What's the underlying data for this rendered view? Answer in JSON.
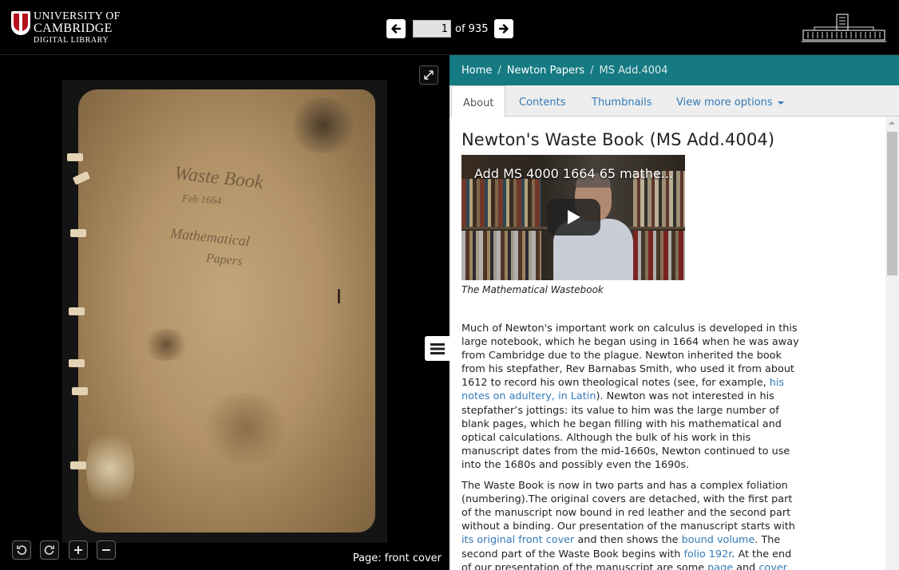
{
  "header": {
    "logo": {
      "line1": "UNIVERSITY OF",
      "line2": "CAMBRIDGE",
      "line3": "DIGITAL LIBRARY"
    },
    "pager": {
      "current_page": "1",
      "of_label": "of 935"
    }
  },
  "viewer": {
    "page_label": "Page: front cover",
    "cover_inscription": [
      "Waste Book",
      "Feb 1664",
      "Mathematical",
      "Papers"
    ]
  },
  "breadcrumb": {
    "home": "Home",
    "collection": "Newton Papers",
    "current": "MS Add.4004"
  },
  "tabs": {
    "about": "About",
    "contents": "Contents",
    "thumbnails": "Thumbnails",
    "more": "View more options"
  },
  "article": {
    "title": "Newton's Waste Book (MS Add.4004)",
    "video_title": "Add MS 4000 1664 65 mathe...",
    "video_caption": "The Mathematical Wastebook",
    "p1_a": "Much of Newton's important work on calculus is developed in this large notebook, which he began using in 1664 when he was away from Cambridge due to the plague. Newton inherited the book from his stepfather, Rev Barnabas Smith, who used it from about 1612 to record his own theological notes (see, for example, ",
    "p1_link": "his notes on adultery, in Latin",
    "p1_b": "). Newton was not interested in his stepfather’s jottings: its value to him was the large number of blank pages, which he began filling with his mathematical and optical calculations. Although the bulk of his work in this manuscript dates from the mid-1660s, Newton continued to use into the 1680s and possibly even the 1690s.",
    "p2_a": "The Waste Book is now in two parts and has a complex foliation (numbering).The original covers are detached, with the first part of the manuscript now bound in red leather and the second part without a binding. Our presentation of the manuscript starts with ",
    "p2_link1": "its original front cover",
    "p2_b": " and then shows the ",
    "p2_link2": "bound volume",
    "p2_c": ". The second part of the Waste Book begins with ",
    "p2_link3": "folio 192r",
    "p2_d": ". At the end of our presentation of the manuscript are some ",
    "p2_link4": "page",
    "p2_e": " and ",
    "p2_link5": "cover"
  },
  "colors": {
    "breadcrumb_bg": "#157a82",
    "link": "#337ab7",
    "topbar": "#000000"
  },
  "icons": [
    "cambridge-shield-icon",
    "arrow-left-icon",
    "arrow-right-icon",
    "library-building-icon",
    "fullscreen-icon",
    "rotate-left-icon",
    "rotate-right-icon",
    "zoom-in-icon",
    "zoom-out-icon",
    "hamburger-menu-icon",
    "play-icon",
    "caret-down-icon"
  ]
}
